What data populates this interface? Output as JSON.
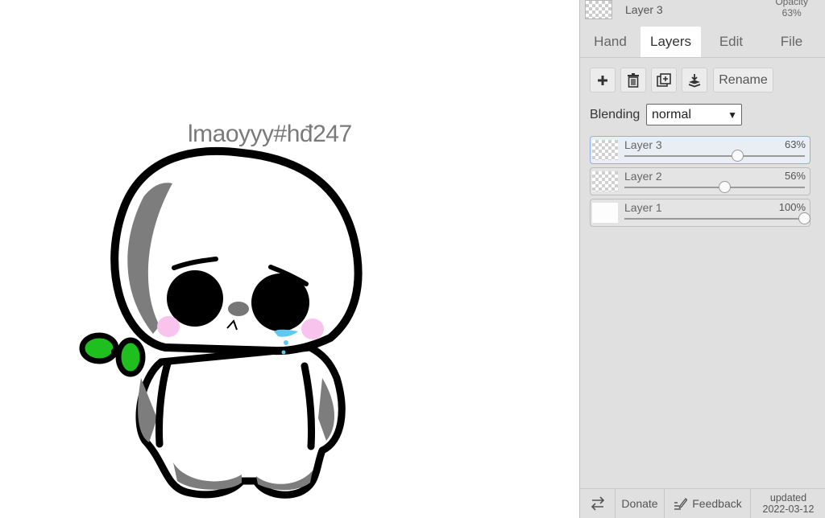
{
  "canvas": {
    "text": "lmaoyyy#hđ247"
  },
  "panel": {
    "current_layer": {
      "name": "Layer 3",
      "opacity_label": "Opacity",
      "opacity_value": "63%"
    },
    "tabs": [
      "Hand",
      "Layers",
      "Edit",
      "File"
    ],
    "active_tab": "Layers",
    "toolbar": {
      "add_icon": "plus-icon",
      "delete_icon": "trash-icon",
      "duplicate_icon": "duplicate-icon",
      "merge_icon": "merge-down-icon",
      "rename_label": "Rename"
    },
    "blending": {
      "label": "Blending",
      "value": "normal"
    },
    "layers": [
      {
        "name": "Layer 3",
        "percent": "63%",
        "opacity": 0.63,
        "selected": true
      },
      {
        "name": "Layer 2",
        "percent": "56%",
        "opacity": 0.56,
        "selected": false
      },
      {
        "name": "Layer 1",
        "percent": "100%",
        "opacity": 1.0,
        "selected": false
      }
    ]
  },
  "footer": {
    "swap_icon": "swap-arrows-icon",
    "donate_label": "Donate",
    "feedback_icon": "feedback-pen-icon",
    "feedback_label": "Feedback",
    "updated_label": "updated",
    "updated_date": "2022-03-12"
  },
  "colors": {
    "panel_bg": "#e0e0e0",
    "selected_layer_border": "#8fb3de",
    "blush": "#f8c3ec",
    "tear": "#5ec8f0",
    "leaf": "#1fbf1f"
  }
}
